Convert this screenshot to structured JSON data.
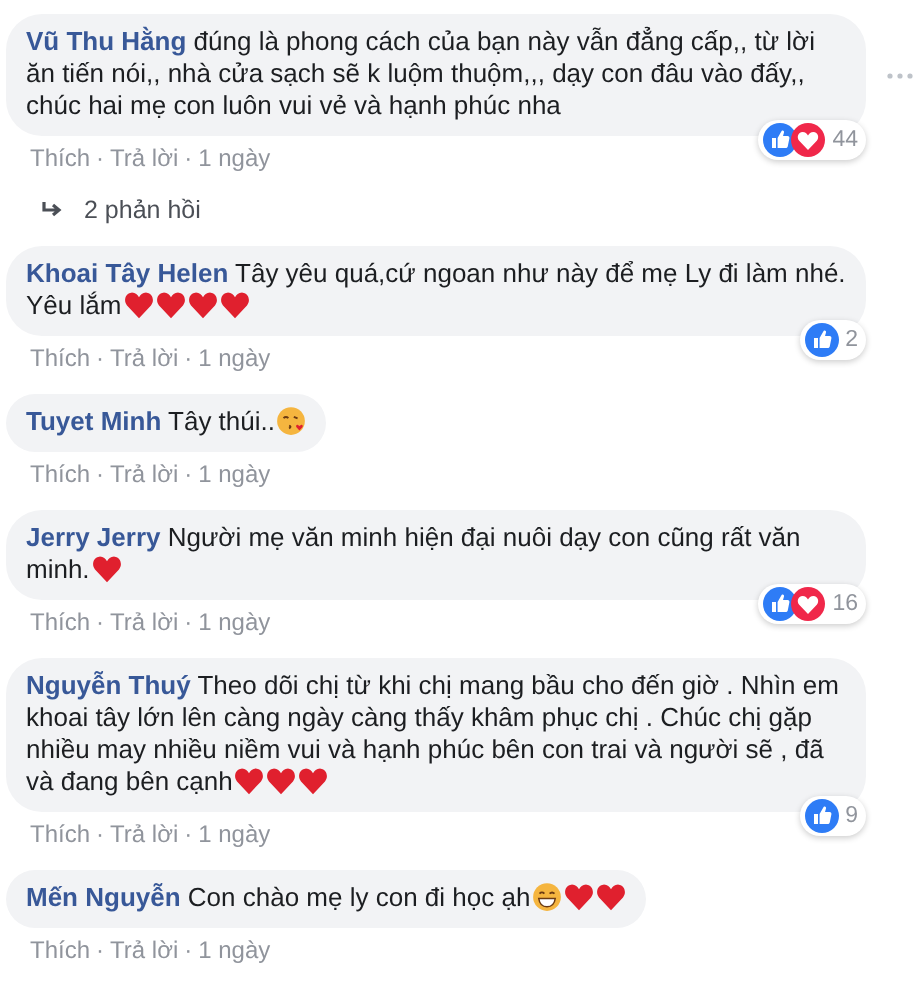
{
  "comments": [
    {
      "author": "Vũ Thu Hằng",
      "text": "đúng là phong cách của bạn này vẫn đẳng cấp,, từ lời ăn tiến nói,, nhà cửa sạch sẽ k luộm thuộm,,, dạy con đâu vào đấy,, chúc hai mẹ con luôn vui vẻ và hạnh phúc nha",
      "reactions": [
        {
          "kind": "like"
        },
        {
          "kind": "love"
        }
      ],
      "reaction_count": "44",
      "more_menu": true,
      "like": "Thích",
      "reply": "Trả lời",
      "separator": "·",
      "time": "1 ngày",
      "replies": "2 phản hồi"
    },
    {
      "author": "Khoai Tây Helen",
      "text": "Tây yêu quá,cứ ngoan như này để mẹ Ly đi làm nhé. Yêu lắm",
      "emojis": [
        {
          "kind": "heart"
        },
        {
          "kind": "heart"
        },
        {
          "kind": "heart"
        },
        {
          "kind": "heart"
        }
      ],
      "reactions": [
        {
          "kind": "like"
        }
      ],
      "reaction_count": "2",
      "more_menu": false,
      "like": "Thích",
      "reply": "Trả lời",
      "separator": "·",
      "time": "1 ngày"
    },
    {
      "author": "Tuyet Minh",
      "text": "Tây thúi..",
      "emojis": [
        {
          "kind": "kiss"
        }
      ],
      "more_menu": false,
      "like": "Thích",
      "reply": "Trả lời",
      "separator": "·",
      "time": "1 ngày"
    },
    {
      "author": "Jerry Jerry",
      "text": "Người mẹ văn minh hiện đại nuôi dạy con cũng rất văn minh.",
      "emojis": [
        {
          "kind": "heart"
        }
      ],
      "reactions": [
        {
          "kind": "like"
        },
        {
          "kind": "love"
        }
      ],
      "reaction_count": "16",
      "more_menu": false,
      "like": "Thích",
      "reply": "Trả lời",
      "separator": "·",
      "time": "1 ngày"
    },
    {
      "author": "Nguyễn Thuý",
      "text": "Theo dõi chị từ khi chị mang bầu cho đến giờ . Nhìn em khoai tây lớn lên càng ngày càng thấy khâm phục chị . Chúc chị gặp nhiều may nhiều niềm vui và hạnh phúc bên con trai và người sẽ , đã và đang bên cạnh",
      "emojis": [
        {
          "kind": "heart"
        },
        {
          "kind": "heart"
        },
        {
          "kind": "heart"
        }
      ],
      "reactions": [
        {
          "kind": "like"
        }
      ],
      "reaction_count": "9",
      "more_menu": false,
      "like": "Thích",
      "reply": "Trả lời",
      "separator": "·",
      "time": "1 ngày"
    },
    {
      "author": "Mến Nguyễn",
      "text": "Con chào mẹ ly con đi học ạh",
      "emojis": [
        {
          "kind": "grin"
        },
        {
          "kind": "heart"
        },
        {
          "kind": "heart"
        }
      ],
      "more_menu": false,
      "like": "Thích",
      "reply": "Trả lời",
      "separator": "·",
      "time": "1 ngày"
    }
  ]
}
